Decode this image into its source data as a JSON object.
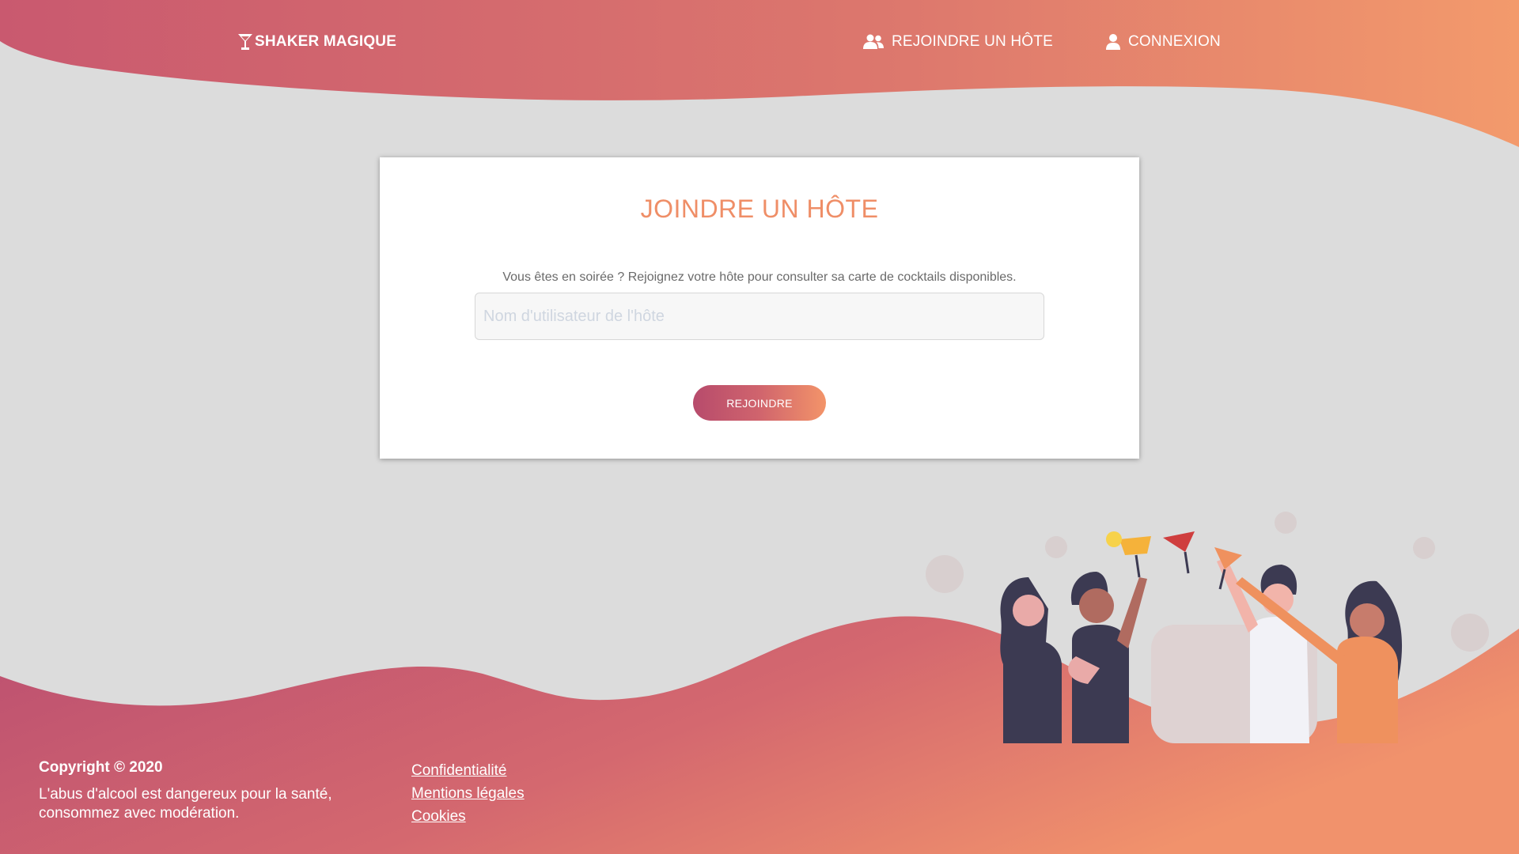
{
  "header": {
    "brand": "SHAKER MAGIQUE",
    "brand_icon": "cocktail-glass-icon",
    "nav": {
      "join_label": "REJOINDRE UN HÔTE",
      "join_icon": "users-icon",
      "login_label": "CONNEXION",
      "login_icon": "user-icon"
    }
  },
  "card": {
    "title": "JOINDRE UN HÔTE",
    "description": "Vous êtes en soirée ? Rejoignez votre hôte pour consulter sa carte de cocktails disponibles.",
    "input": {
      "placeholder": "Nom d'utilisateur de l'hôte",
      "value": ""
    },
    "button_label": "REJOINDRE"
  },
  "footer": {
    "copyright": "Copyright © 2020",
    "warning": "L'abus d'alcool est dangereux pour la santé, consommez avec modération.",
    "links": {
      "privacy": "Confidentialité",
      "legal": "Mentions légales",
      "cookies": "Cookies"
    }
  },
  "colors": {
    "gradient_start": "#b74b6c",
    "gradient_end": "#f39469",
    "title_accent": "#ef8e67",
    "background": "#dcdcdc"
  }
}
